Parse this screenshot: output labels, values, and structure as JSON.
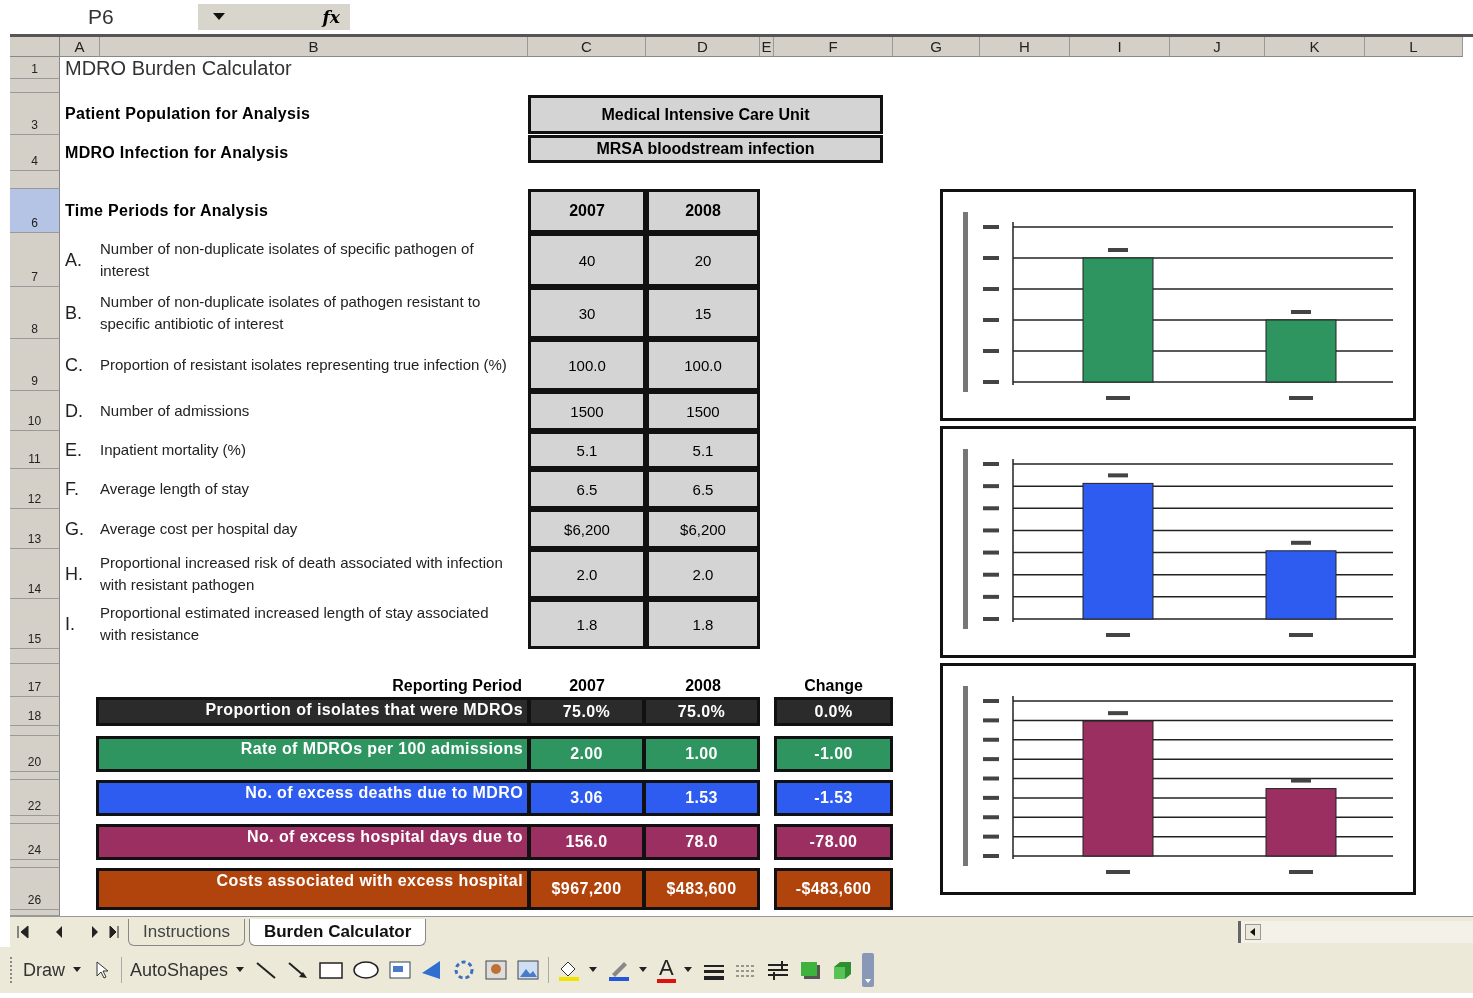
{
  "name_box": "P6",
  "formula_label": "fx",
  "columns": [
    "A",
    "B",
    "C",
    "D",
    "E",
    "F",
    "G",
    "H",
    "I",
    "J",
    "K",
    "L"
  ],
  "rows": [
    {
      "label": "1",
      "selected": false
    },
    {
      "selected": false
    },
    {
      "label": "3",
      "selected": false
    },
    {
      "label": "4",
      "selected": false
    },
    {
      "selected": false
    },
    {
      "label": "6",
      "selected": true
    },
    {
      "label": "7",
      "selected": false
    },
    {
      "label": "8",
      "selected": false
    },
    {
      "label": "9",
      "selected": false
    },
    {
      "label": "10",
      "selected": false
    },
    {
      "label": "11",
      "selected": false
    },
    {
      "label": "12",
      "selected": false
    },
    {
      "label": "13",
      "selected": false
    },
    {
      "label": "14",
      "selected": false
    },
    {
      "label": "15",
      "selected": false
    },
    {
      "selected": false
    },
    {
      "label": "17",
      "selected": false
    },
    {
      "label": "18",
      "selected": false
    },
    {
      "selected": false
    },
    {
      "label": "20",
      "selected": false
    },
    {
      "selected": false
    },
    {
      "label": "22",
      "selected": false
    },
    {
      "selected": false
    },
    {
      "label": "24",
      "selected": false
    },
    {
      "selected": false
    },
    {
      "label": "26",
      "selected": false
    },
    {
      "selected": false
    }
  ],
  "title": "MDRO Burden Calculator",
  "parameters": [
    {
      "label": "Patient Population for Analysis",
      "value": "Medical Intensive Care Unit"
    },
    {
      "label": "MDRO Infection for Analysis",
      "value": "MRSA bloodstream infection"
    }
  ],
  "time_periods": {
    "label": "Time Periods for Analysis",
    "years": [
      "2007",
      "2008"
    ]
  },
  "inputs": [
    {
      "letter": "A.",
      "text": "Number of non-duplicate isolates of specific pathogen of interest",
      "values": [
        "40",
        "20"
      ]
    },
    {
      "letter": "B.",
      "text": "Number of non-duplicate isolates of pathogen resistant to specific antibiotic of interest",
      "values": [
        "30",
        "15"
      ]
    },
    {
      "letter": "C.",
      "text": "Proportion of resistant isolates representing true infection (%)",
      "values": [
        "100.0",
        "100.0"
      ]
    },
    {
      "letter": "D.",
      "text": "Number of admissions",
      "values": [
        "1500",
        "1500"
      ]
    },
    {
      "letter": "E.",
      "text": "Inpatient mortality (%)",
      "values": [
        "5.1",
        "5.1"
      ]
    },
    {
      "letter": "F.",
      "text": "Average length of stay",
      "values": [
        "6.5",
        "6.5"
      ]
    },
    {
      "letter": "G.",
      "text": "Average cost per hospital day",
      "values": [
        "$6,200",
        "$6,200"
      ]
    },
    {
      "letter": "H.",
      "text": "Proportional increased risk of death associated with infection with resistant pathogen",
      "values": [
        "2.0",
        "2.0"
      ]
    },
    {
      "letter": "I.",
      "text": "Proportional estimated increased length of stay associated with resistance",
      "values": [
        "1.8",
        "1.8"
      ]
    }
  ],
  "results": {
    "header": {
      "label": "Reporting Period",
      "columns": [
        "2007",
        "2008",
        "Change"
      ]
    },
    "rows": [
      {
        "label": "Proportion of isolates that were MDROs",
        "values": [
          "75.0%",
          "75.0%"
        ],
        "change": "0.0%",
        "color": "#2b2b2b"
      },
      {
        "label": "Rate of MDROs per 100 admissions",
        "values": [
          "2.00",
          "1.00"
        ],
        "change": "-1.00",
        "color": "#2e9460"
      },
      {
        "label": "No. of excess deaths due to MDRO",
        "values": [
          "3.06",
          "1.53"
        ],
        "change": "-1.53",
        "color": "#2f5cf0"
      },
      {
        "label": "No. of excess hospital days due to",
        "values": [
          "156.0",
          "78.0"
        ],
        "change": "-78.00",
        "color": "#9c2f62"
      },
      {
        "label": "Costs associated with excess hospital",
        "values": [
          "$967,200",
          "$483,600"
        ],
        "change": "-$483,600",
        "color": "#b0440c"
      }
    ]
  },
  "sheet_tabs": [
    {
      "label": "Instructions",
      "selected": false
    },
    {
      "label": "Burden Calculator",
      "selected": true
    }
  ],
  "draw_toolbar": {
    "draw": "Draw",
    "autoshapes": "AutoShapes",
    "font_color_glyph": "A"
  }
}
